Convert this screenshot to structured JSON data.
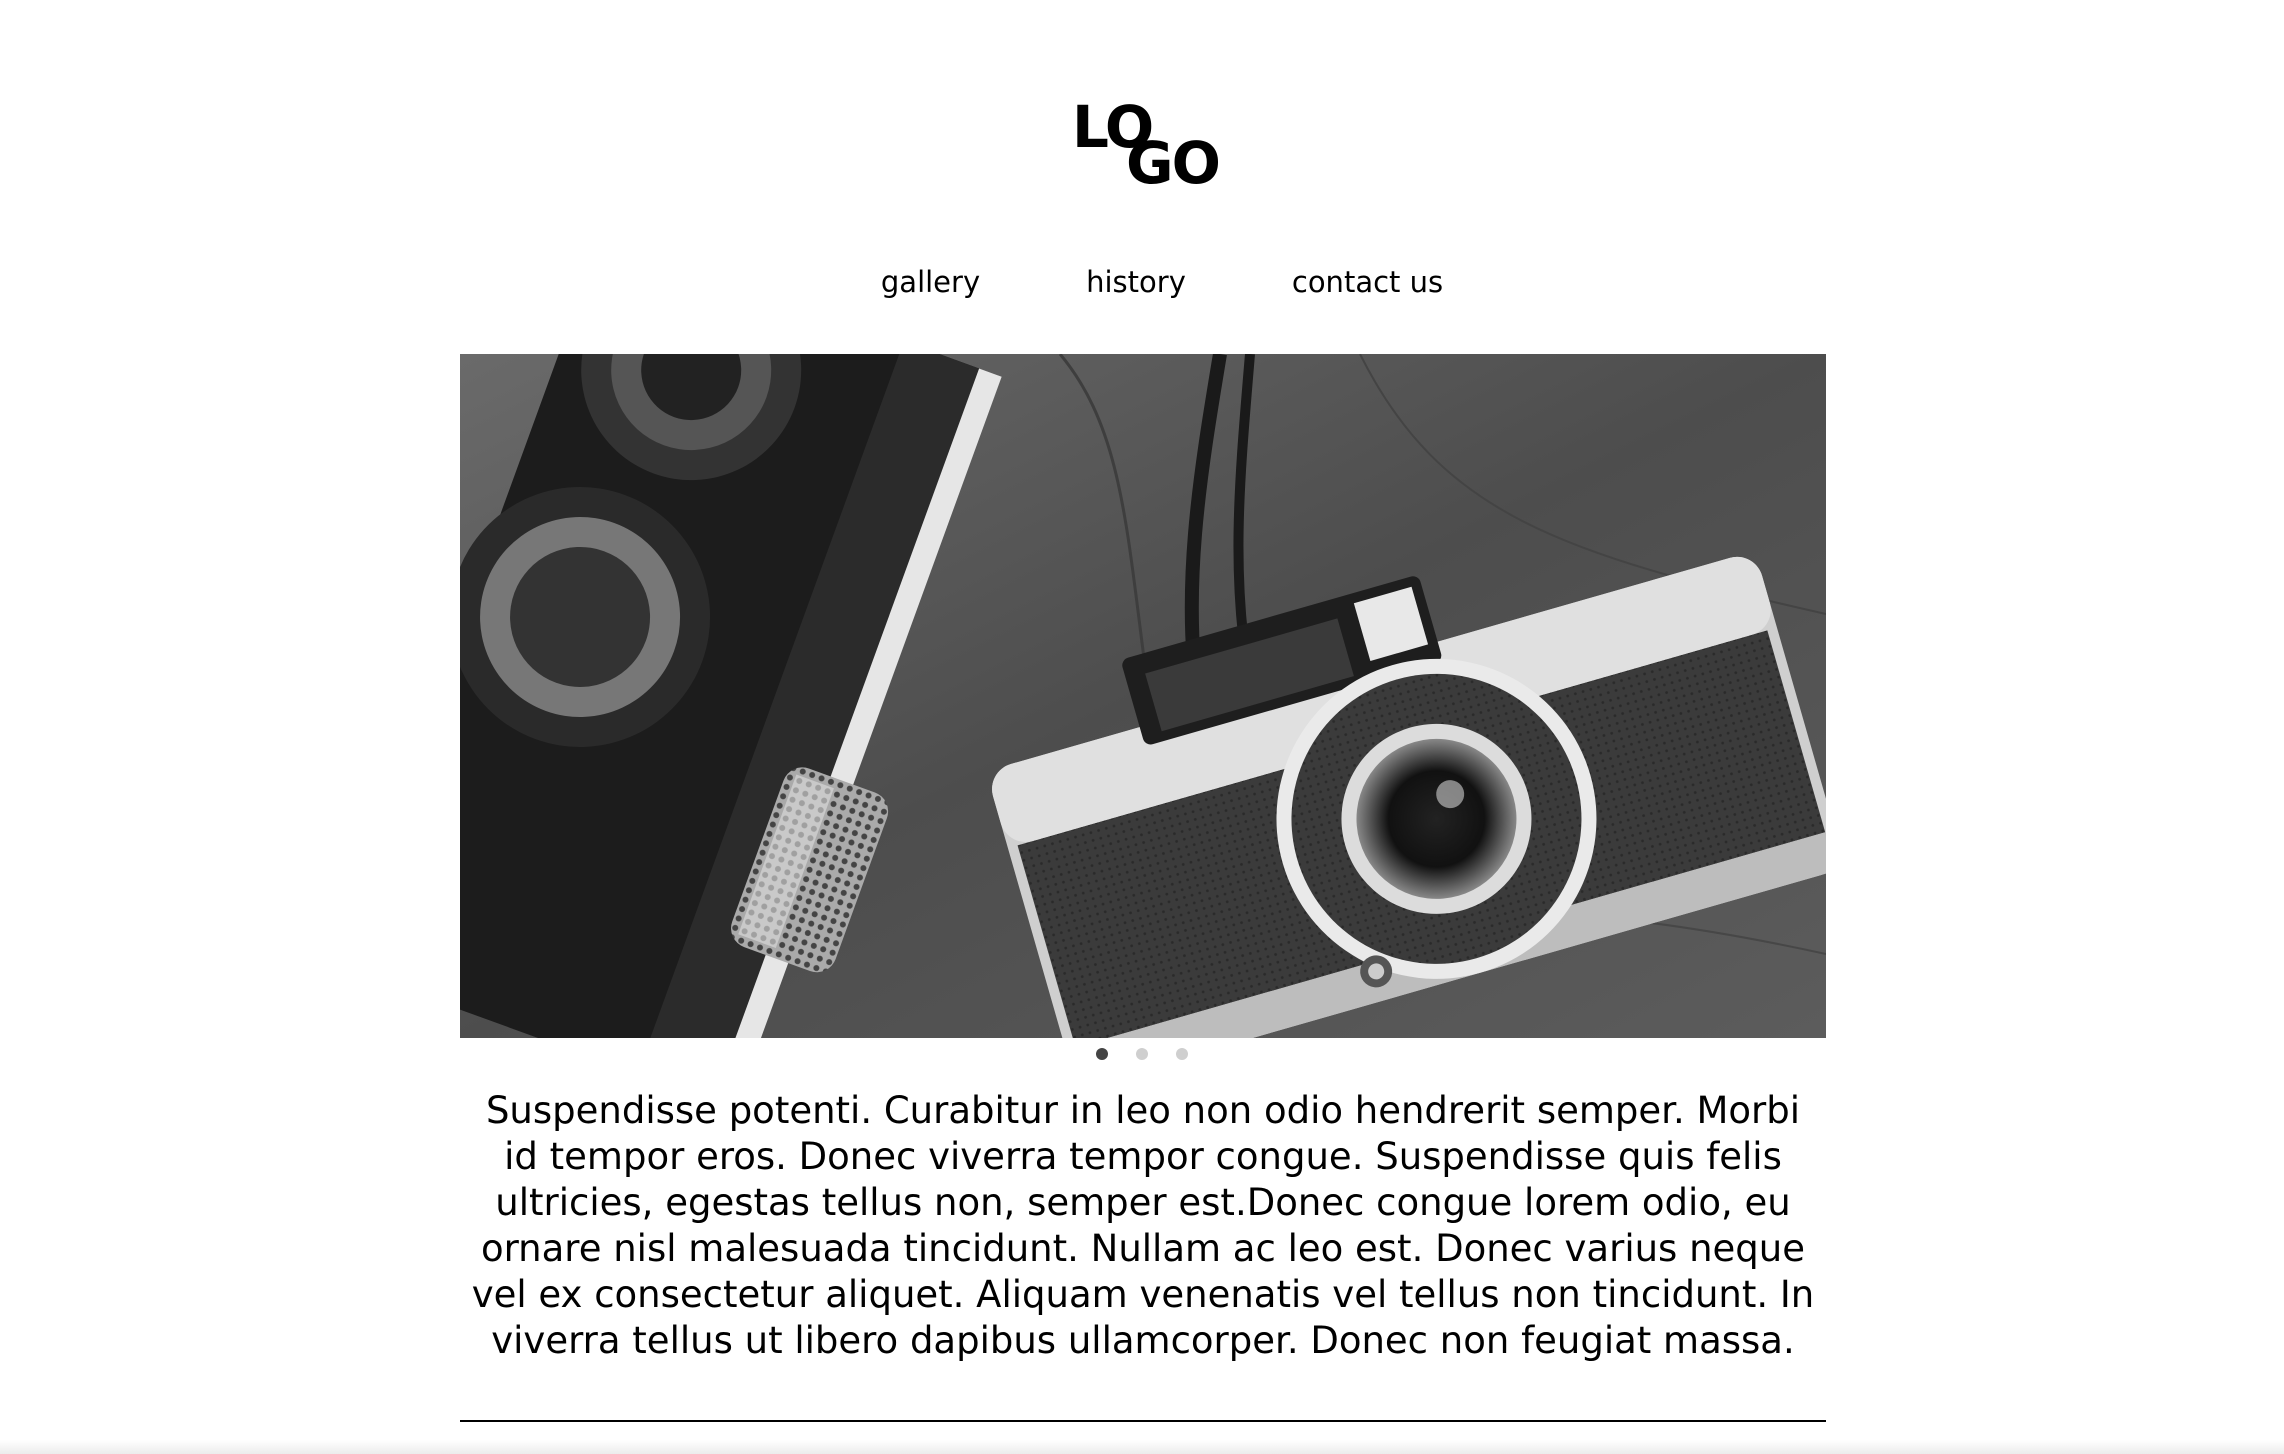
{
  "logo": {
    "line1": "LO",
    "line2": "GO"
  },
  "nav": {
    "items": [
      {
        "label": "gallery"
      },
      {
        "label": "history"
      },
      {
        "label": "contact us"
      }
    ]
  },
  "carousel": {
    "image_subject": "black-and-white photo of two vintage cameras on a wooden surface",
    "slide_count": 3,
    "active_slide": 1
  },
  "main": {
    "description": "Suspendisse potenti. Curabitur in leo non odio hendrerit semper. Morbi id tempor eros. Donec viverra tempor congue. Suspendisse quis felis ultricies, egestas tellus non, semper est.Donec congue lorem odio, eu ornare nisl malesuada tincidunt. Nullam ac leo est. Donec varius neque vel ex consectetur aliquet. Aliquam venenatis vel tellus non tincidunt. In viverra tellus ut libero dapibus ullamcorper. Donec non feugiat massa."
  },
  "colors": {
    "text": "#000000",
    "background": "#ffffff",
    "dot_active": "#444444",
    "dot_inactive": "#cfcfcf"
  }
}
